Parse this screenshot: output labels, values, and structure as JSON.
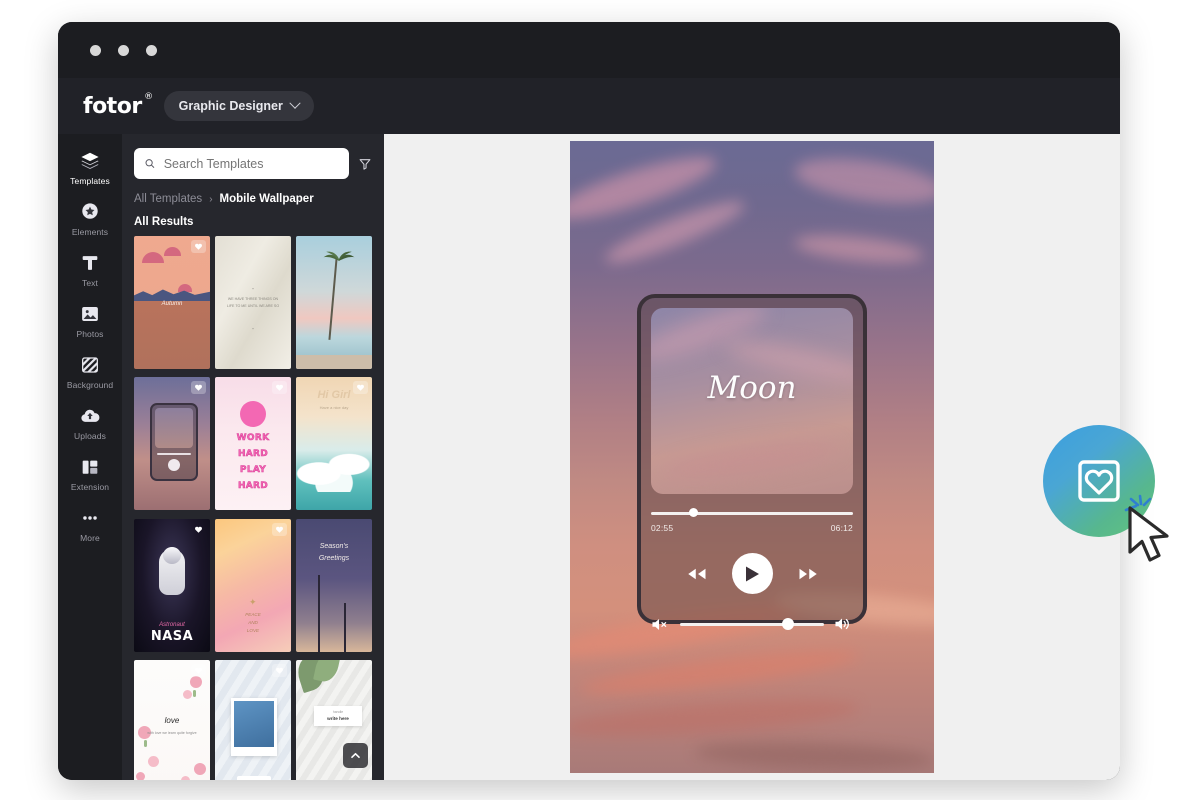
{
  "window": {
    "traffic_lights": [
      "close",
      "minimize",
      "maximize"
    ]
  },
  "header": {
    "logo": "fotor",
    "logo_mark": "®",
    "mode_label": "Graphic Designer",
    "mode_icon": "chevron-down-icon"
  },
  "sidebar": {
    "items": [
      {
        "label": "Templates",
        "icon": "layers-icon",
        "active": true
      },
      {
        "label": "Elements",
        "icon": "star-badge-icon",
        "active": false
      },
      {
        "label": "Text",
        "icon": "text-t-icon",
        "active": false
      },
      {
        "label": "Photos",
        "icon": "photo-icon",
        "active": false
      },
      {
        "label": "Background",
        "icon": "hatch-square-icon",
        "active": false
      },
      {
        "label": "Uploads",
        "icon": "cloud-upload-icon",
        "active": false
      },
      {
        "label": "Extension",
        "icon": "extension-icon",
        "active": false
      },
      {
        "label": "More",
        "icon": "ellipsis-icon",
        "active": false
      }
    ]
  },
  "panel": {
    "search": {
      "placeholder": "Search Templates",
      "value": "",
      "icon": "search-icon"
    },
    "filter_icon": "filter-funnel-icon",
    "breadcrumb": {
      "root": "All Templates",
      "separator": "›",
      "current": "Mobile Wallpaper"
    },
    "results_label": "All Results",
    "scroll_top_icon": "chevron-up-icon",
    "templates": [
      {
        "name": "mountain-sunset-landscape",
        "favorite_badge": true,
        "badge_style": "filled",
        "caption": "Autumn"
      },
      {
        "name": "minimal-quote-beige",
        "favorite_badge": false,
        "badge_style": "none",
        "quote_mark": "“",
        "body": "WE HAVE THREE THINGS ON LIFE TO ME UNTIL WE ARE SO"
      },
      {
        "name": "palm-tree-beach",
        "favorite_badge": false,
        "badge_style": "none",
        "caption": ""
      },
      {
        "name": "retro-music-player-sky",
        "favorite_badge": true,
        "badge_style": "filled",
        "caption": ""
      },
      {
        "name": "work-hard-play-hard-pink",
        "favorite_badge": true,
        "badge_style": "filled",
        "lines": [
          "WORK",
          "HARD",
          "PLAY",
          "HARD"
        ]
      },
      {
        "name": "ocean-wave-beige",
        "favorite_badge": true,
        "badge_style": "filled",
        "title": "Hi Girl",
        "subtitle": "Have a nice day"
      },
      {
        "name": "nasa-astronaut-space",
        "favorite_badge": true,
        "badge_style": "plain",
        "title": "NASA",
        "subtitle": "Astronaut"
      },
      {
        "name": "peace-and-love-gradient",
        "favorite_badge": true,
        "badge_style": "filled",
        "lines": [
          "PEACE",
          "AND",
          "LOVE"
        ]
      },
      {
        "name": "seasons-greetings-night",
        "favorite_badge": false,
        "badge_style": "none",
        "lines": [
          "Season's",
          "Greetings"
        ]
      },
      {
        "name": "love-floral-white",
        "favorite_badge": true,
        "badge_style": "filled",
        "title": "love",
        "subtitle": "with love we learn quite forgive"
      },
      {
        "name": "photo-frame-card-blue",
        "favorite_badge": true,
        "badge_style": "filled",
        "caption": ""
      },
      {
        "name": "plant-note-minimal",
        "favorite_badge": false,
        "badge_style": "none",
        "note_small": "handle",
        "note_big": "write here"
      }
    ]
  },
  "canvas": {
    "artboard_name": "mobile-wallpaper-sunset-sky",
    "player": {
      "track_title": "Moon",
      "time_elapsed": "02:55",
      "time_total": "06:12",
      "progress_percent": 21,
      "volume_percent": 75,
      "controls": {
        "previous_icon": "rewind-icon",
        "play_icon": "play-icon",
        "next_icon": "fast-forward-icon",
        "mute_icon": "volume-mute-icon",
        "volume_icon": "volume-high-icon"
      }
    }
  },
  "floating_action": {
    "name": "favorite-template-button",
    "icon": "heart-in-square-icon",
    "gradient_from": "#3b9fe0",
    "gradient_to": "#63c57f",
    "cursor_icon": "mouse-pointer-icon",
    "click_burst_icon": "click-burst-icon",
    "burst_color": "#2f7fd0"
  },
  "colors": {
    "window_chrome": "#1c1d21",
    "app_header": "#212228",
    "panel_bg": "#26272d",
    "canvas_bg": "#f0f0f0",
    "accent_pink": "#f368b3"
  }
}
